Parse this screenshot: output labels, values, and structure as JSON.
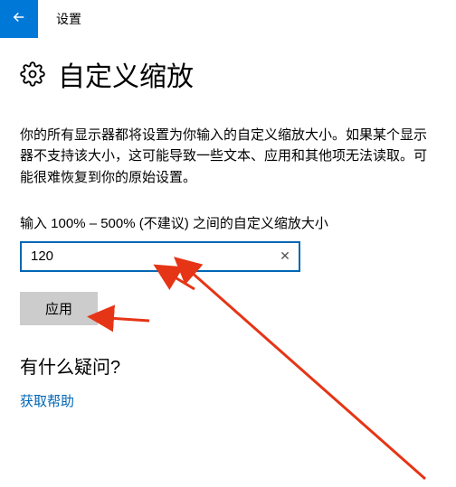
{
  "titlebar": {
    "title": "设置"
  },
  "page": {
    "heading": "自定义缩放",
    "description": "你的所有显示器都将设置为你输入的自定义缩放大小。如果某个显示器不支持该大小，这可能导致一些文本、应用和其他项无法读取。可能很难恢复到你的原始设置。",
    "field_label": "输入 100% – 500% (不建议) 之间的自定义缩放大小",
    "input_value": "120",
    "apply_label": "应用"
  },
  "help": {
    "heading": "有什么疑问?",
    "link": "获取帮助"
  }
}
